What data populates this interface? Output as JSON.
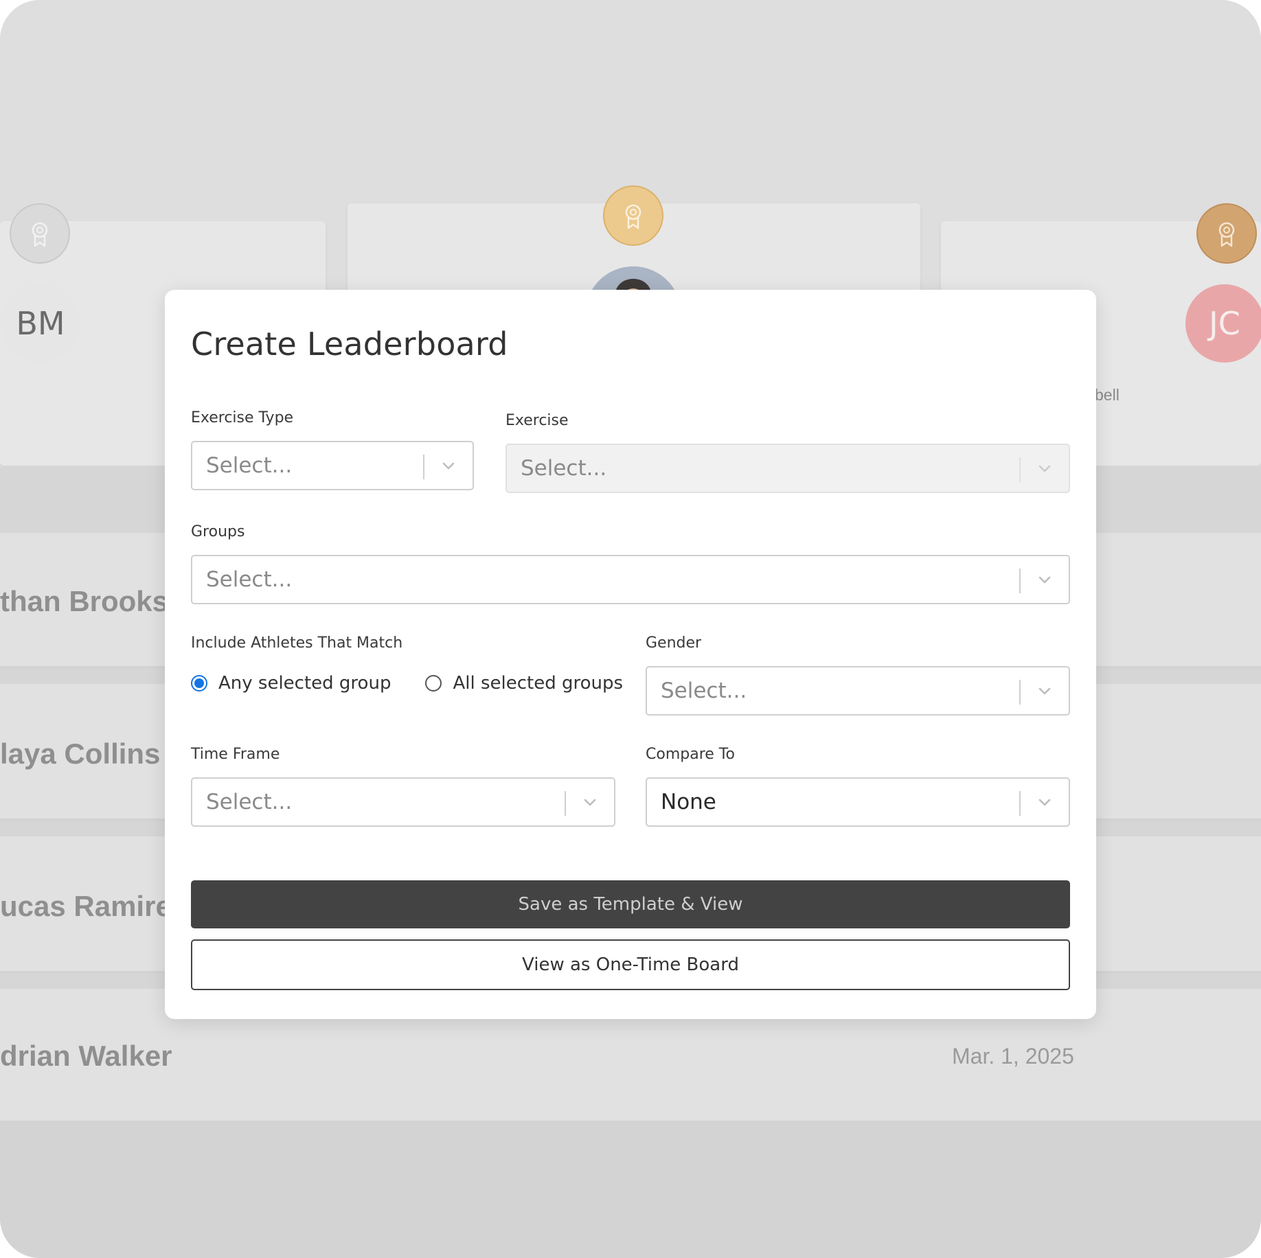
{
  "background": {
    "podium": {
      "left": {
        "initials": "BM",
        "medal": "medal-ribbon-icon",
        "medal_color": "#dadada"
      },
      "center": {
        "medal": "medal-ribbon-icon",
        "medal_color": "#ecc98d"
      },
      "right": {
        "initials": "JC",
        "medal": "medal-ribbon-icon",
        "medal_color": "#d2a470",
        "name_fragment": "bell"
      }
    },
    "rows": [
      {
        "name": "than Brooks"
      },
      {
        "name": "laya Collins"
      },
      {
        "name": "ucas Ramirez"
      },
      {
        "name": "drian Walker",
        "date": "Mar. 1, 2025"
      }
    ]
  },
  "modal": {
    "title": "Create Leaderboard",
    "exercise_type": {
      "label": "Exercise Type",
      "placeholder": "Select..."
    },
    "exercise": {
      "label": "Exercise",
      "placeholder": "Select...",
      "disabled": true
    },
    "groups": {
      "label": "Groups",
      "placeholder": "Select..."
    },
    "include_match": {
      "label": "Include Athletes That Match",
      "options": [
        {
          "label": "Any selected group",
          "checked": true
        },
        {
          "label": "All selected groups",
          "checked": false
        }
      ]
    },
    "gender": {
      "label": "Gender",
      "placeholder": "Select..."
    },
    "time_frame": {
      "label": "Time Frame",
      "placeholder": "Select..."
    },
    "compare_to": {
      "label": "Compare To",
      "value": "None"
    },
    "save_button": "Save as Template & View",
    "one_time_button": "View as One-Time Board",
    "colors": {
      "primary_button": "#434343",
      "radio_accent": "#1474e6"
    }
  }
}
